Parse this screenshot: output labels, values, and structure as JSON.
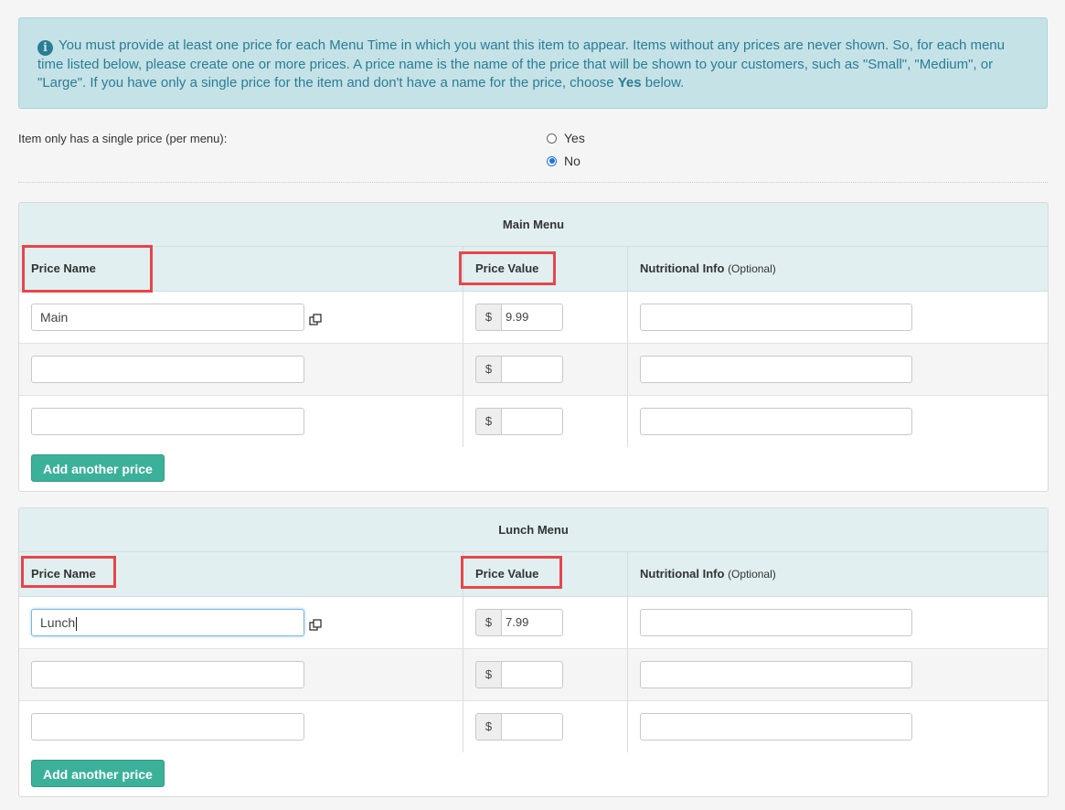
{
  "info": {
    "text_before_bold": "You must provide at least one price for each Menu Time in which you want this item to appear. Items without any prices are never shown. So, for each menu time listed below, please create one or more prices. A price name is the name of the price that will be shown to your customers, such as \"Small\", \"Medium\", or \"Large\". If you have only a single price for the item and don't have a name for the price, choose ",
    "bold": "Yes",
    "text_after_bold": " below."
  },
  "single_price": {
    "label": "Item only has a single price (per menu):",
    "options": [
      "Yes",
      "No"
    ],
    "selected": "No"
  },
  "columns": {
    "price_name": "Price Name",
    "price_value": "Price Value",
    "nutritional": "Nutritional Info",
    "optional": "(Optional)"
  },
  "currency_symbol": "$",
  "panels": [
    {
      "title": "Main Menu",
      "rows": [
        {
          "name": "Main",
          "value": "9.99"
        },
        {
          "name": "",
          "value": ""
        },
        {
          "name": "",
          "value": ""
        }
      ],
      "add_label": "Add another price"
    },
    {
      "title": "Lunch Menu",
      "rows": [
        {
          "name": "Lunch",
          "value": "7.99"
        },
        {
          "name": "",
          "value": ""
        },
        {
          "name": "",
          "value": ""
        }
      ],
      "add_label": "Add another price"
    }
  ],
  "colors": {
    "info_bg": "#c5e2e7",
    "info_text": "#2a7d95",
    "button": "#3cb19a",
    "highlight": "#e8454a"
  }
}
